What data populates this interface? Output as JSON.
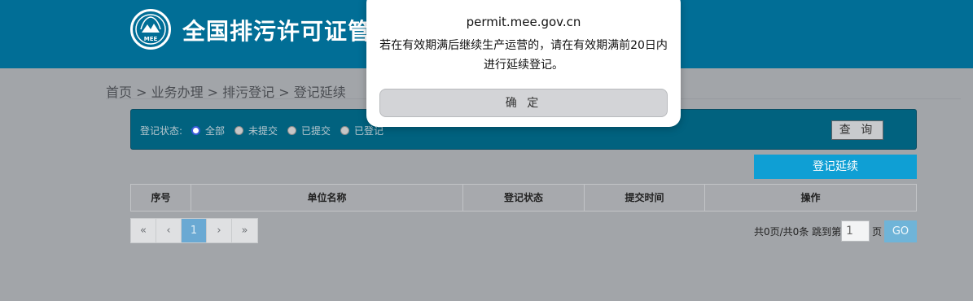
{
  "header": {
    "site_title": "全国排污许可证管理",
    "logo_text": "MEE"
  },
  "breadcrumb": {
    "text": "首页 > 业务办理 > 排污登记 > 登记延续"
  },
  "filter": {
    "label": "登记状态:",
    "options": [
      "全部",
      "未提交",
      "已提交",
      "已登记"
    ],
    "selected": "全部",
    "query_button": "查 询"
  },
  "actions": {
    "renew_button": "登记延续"
  },
  "table": {
    "headers": [
      "序号",
      "单位名称",
      "登记状态",
      "提交时间",
      "操作"
    ]
  },
  "pagination": {
    "first": "«",
    "prev": "‹",
    "current": "1",
    "next": "›",
    "last": "»",
    "info": "共0页/共0条 跳到第",
    "jump_value": "1",
    "suffix": "页",
    "go_button": "GO"
  },
  "dialog": {
    "title": "permit.mee.gov.cn",
    "message_line1": "若在有效期满后继续生产运营的，请在有效期满前20日内",
    "message_line2": "进行延续登记。",
    "ok_button": "确 定"
  },
  "colors": {
    "header": "#016e96",
    "filter_bar": "#01627f",
    "accent": "#0f9fd4",
    "overlay_bg": "#a2a5a9"
  }
}
